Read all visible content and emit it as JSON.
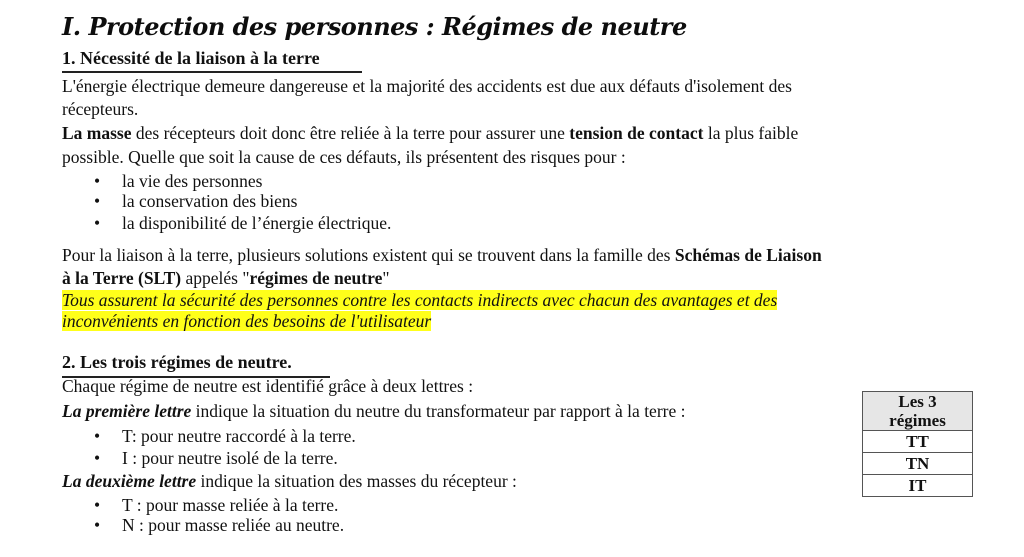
{
  "title": "I. Protection des personnes : Régimes de neutre",
  "section1": {
    "heading": "1.  Nécessité de la liaison à la terre",
    "p1_line1": "L'énergie électrique demeure dangereuse et la majorité des accidents est due aux défauts d'isolement des",
    "p1_line2": "récepteurs.",
    "p2_bold1": "La masse",
    "p2_text1": " des récepteurs doit donc être reliée à la terre pour assurer une ",
    "p2_bold2": "tension de contact",
    "p2_text2": " la plus faible",
    "p2_line2": "possible. Quelle que soit la cause de ces défauts, ils présentent des risques pour :",
    "bullets": [
      "la vie des personnes",
      "la conservation des biens",
      "la disponibilité de l’énergie électrique."
    ],
    "p3_text1": "Pour la liaison à la terre, plusieurs solutions existent qui se trouvent dans la famille des ",
    "p3_bold1": "Schémas de Liaison",
    "p3_bold2": "à la Terre (SLT)",
    "p3_text2": " appelés \"",
    "p3_bold3": "régimes de neutre",
    "p3_text3": "\"",
    "highlight_line1": "Tous assurent la sécurité des personnes contre les contacts indirects avec chacun des avantages et des",
    "highlight_line2": "inconvénients en fonction des besoins de l'utilisateur"
  },
  "section2": {
    "heading": "2.  Les trois régimes de neutre.",
    "intro": " Chaque régime de neutre est identifié grâce à deux lettres :",
    "first_label": "La première lettre",
    "first_text": " indique la situation du neutre du transformateur par rapport à la terre :",
    "first_bullets": [
      "T: pour neutre raccordé à la terre.",
      "I : pour neutre isolé de la terre."
    ],
    "second_label": "La deuxième lettre",
    "second_text": " indique la situation des masses du récepteur :",
    "second_bullets": [
      "T : pour masse reliée à la terre.",
      "N : pour masse reliée au neutre."
    ]
  },
  "table": {
    "header_line1": "Les 3",
    "header_line2": "régimes",
    "rows": [
      "TT",
      "TN",
      "IT"
    ]
  },
  "bullet_char": "•"
}
